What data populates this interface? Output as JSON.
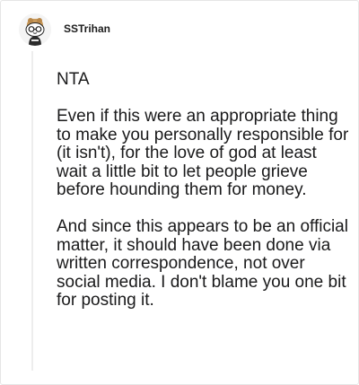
{
  "comment": {
    "username": "SSTrihan",
    "avatar_icon": "snoo-avatar-icon",
    "paragraphs": [
      "NTA",
      "Even if this were an appropriate thing to make you personally responsible for (it isn't), for the love of god at least wait a little bit to let people grieve before hounding them for money.",
      "And since this appears to be an official matter, it should have been done via written correspondence, not over social media. I don't blame you one bit for posting it."
    ]
  },
  "colors": {
    "text": "#1a1a1b",
    "thread_line": "#ededed",
    "avatar_background": "#f4f4f4"
  }
}
